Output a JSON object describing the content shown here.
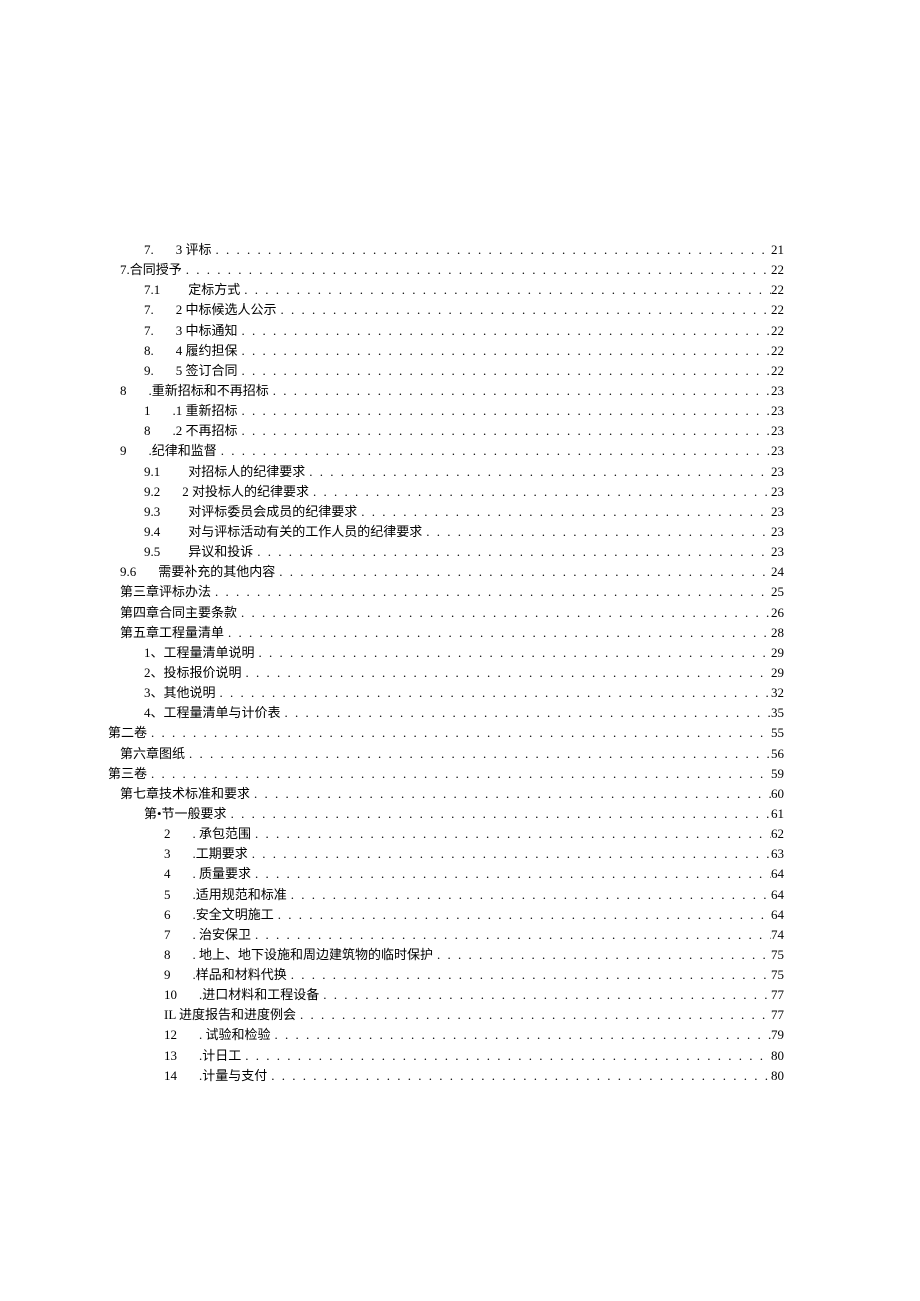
{
  "toc": [
    {
      "indent": 2,
      "num": "7.",
      "label": "3 评标",
      "page": "21",
      "gap": "md"
    },
    {
      "indent": 1,
      "num": "",
      "label": "7.合同授予",
      "page": "22",
      "gap": "sm"
    },
    {
      "indent": 2,
      "num": "7.1",
      "label": "定标方式",
      "page": "22",
      "gap": "lg"
    },
    {
      "indent": 2,
      "num": "7.",
      "label": "2 中标候选人公示",
      "page": "22",
      "gap": "md"
    },
    {
      "indent": 2,
      "num": "7.",
      "label": "3 中标通知",
      "page": "22",
      "gap": "md"
    },
    {
      "indent": 2,
      "num": "8.",
      "label": "4 履约担保",
      "page": "22",
      "gap": "md"
    },
    {
      "indent": 2,
      "num": "9.",
      "label": "5 签订合同",
      "page": "22",
      "gap": "md"
    },
    {
      "indent": 1,
      "num": "8",
      "label": ".重新招标和不再招标",
      "page": "23",
      "gap": "md"
    },
    {
      "indent": 2,
      "num": "1",
      "label": ".1 重新招标",
      "page": "23",
      "gap": "md"
    },
    {
      "indent": 2,
      "num": "8",
      "label": ".2 不再招标",
      "page": "23",
      "gap": "md"
    },
    {
      "indent": 1,
      "num": "9",
      "label": ".纪律和监督",
      "page": "23",
      "gap": "md"
    },
    {
      "indent": 2,
      "num": "9.1",
      "label": "对招标人的纪律要求",
      "page": "23",
      "gap": "lg"
    },
    {
      "indent": 2,
      "num": "9.2",
      "label": "2 对投标人的纪律要求",
      "page": "23",
      "gap": "md"
    },
    {
      "indent": 2,
      "num": "9.3",
      "label": "对评标委员会成员的纪律要求",
      "page": "23",
      "gap": "lg"
    },
    {
      "indent": 2,
      "num": "9.4",
      "label": "对与评标活动有关的工作人员的纪律要求",
      "page": "23",
      "gap": "lg"
    },
    {
      "indent": 2,
      "num": "9.5",
      "label": "异议和投诉",
      "page": "23",
      "gap": "lg"
    },
    {
      "indent": 1,
      "num": "9.6",
      "label": "需要补充的其他内容",
      "page": "24",
      "gap": "md"
    },
    {
      "indent": 1,
      "num": "",
      "label": "第三章评标办法",
      "page": "25",
      "gap": "sm"
    },
    {
      "indent": 1,
      "num": "",
      "label": "第四章合同主要条款",
      "page": "26",
      "gap": "sm"
    },
    {
      "indent": 1,
      "num": "",
      "label": "第五章工程量清单",
      "page": "28",
      "gap": "sm"
    },
    {
      "indent": 2,
      "num": "",
      "label": "1、工程量清单说明",
      "page": "29",
      "gap": "sm"
    },
    {
      "indent": 2,
      "num": "",
      "label": "2、投标报价说明",
      "page": "29",
      "gap": "sm"
    },
    {
      "indent": 2,
      "num": "",
      "label": "3、其他说明",
      "page": "32",
      "gap": "sm"
    },
    {
      "indent": 2,
      "num": "",
      "label": "4、工程量清单与计价表",
      "page": "35",
      "gap": "sm"
    },
    {
      "indent": 0,
      "num": "",
      "label": "第二卷",
      "page": "55",
      "gap": "sm"
    },
    {
      "indent": 1,
      "num": "",
      "label": "第六章图纸",
      "page": "56",
      "gap": "sm"
    },
    {
      "indent": 0,
      "num": "",
      "label": "第三卷",
      "page": "59",
      "gap": "sm"
    },
    {
      "indent": 1,
      "num": "",
      "label": "第七章技术标准和要求",
      "page": "60",
      "gap": "sm"
    },
    {
      "indent": 2,
      "num": "",
      "label": "第•节一般要求",
      "page": "61",
      "gap": "sm"
    },
    {
      "indent": 3,
      "num": "2",
      "label": ". 承包范围",
      "page": "62",
      "gap": "md"
    },
    {
      "indent": 3,
      "num": "3",
      "label": ".工期要求",
      "page": "63",
      "gap": "md"
    },
    {
      "indent": 3,
      "num": "4",
      "label": ". 质量要求",
      "page": "64",
      "gap": "md"
    },
    {
      "indent": 3,
      "num": "5",
      "label": ".适用规范和标准",
      "page": "64",
      "gap": "md"
    },
    {
      "indent": 3,
      "num": "6",
      "label": ".安全文明施工",
      "page": "64",
      "gap": "md"
    },
    {
      "indent": 3,
      "num": "7",
      "label": ". 治安保卫",
      "page": "74",
      "gap": "md"
    },
    {
      "indent": 3,
      "num": "8",
      "label": ". 地上、地下设施和周边建筑物的临时保护",
      "page": "75",
      "gap": "md"
    },
    {
      "indent": 3,
      "num": "9",
      "label": ".样品和材料代换",
      "page": "75",
      "gap": "md"
    },
    {
      "indent": 3,
      "num": "10",
      "label": ".进口材料和工程设备",
      "page": "77",
      "gap": "md"
    },
    {
      "indent": 3,
      "num": "",
      "label": "IL 进度报告和进度例会",
      "page": "77",
      "gap": "sm"
    },
    {
      "indent": 3,
      "num": "12",
      "label": ". 试验和检验",
      "page": "79",
      "gap": "md"
    },
    {
      "indent": 3,
      "num": "13",
      "label": ".计日工",
      "page": "80",
      "gap": "md"
    },
    {
      "indent": 3,
      "num": "14",
      "label": ".计量与支付",
      "page": "80",
      "gap": "md"
    }
  ]
}
